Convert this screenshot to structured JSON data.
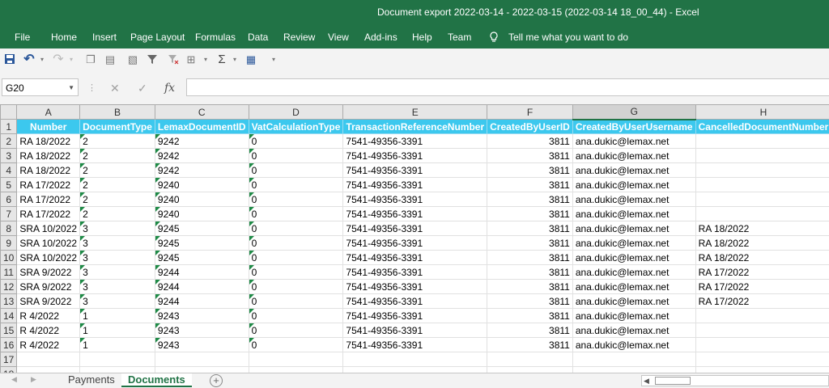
{
  "window": {
    "title": "Document export 2022-03-14 - 2022-03-15 (2022-03-14 18_00_44)  -  Excel"
  },
  "ribbon": {
    "tabs": [
      "File",
      "Home",
      "Insert",
      "Page Layout",
      "Formulas",
      "Data",
      "Review",
      "View",
      "Add-ins",
      "Help",
      "Team"
    ],
    "tell_me": "Tell me what you want to do"
  },
  "quick_access": {
    "icons": [
      "save-icon",
      "undo-icon",
      "redo-icon",
      "copy-icon",
      "paste-icon",
      "format-icon",
      "filter-icon",
      "clear-filter-icon",
      "table-icon",
      "autosum-icon",
      "pivot-icon",
      "customize-icon"
    ]
  },
  "formula_bar": {
    "name_box": "G20",
    "cancel": "✕",
    "enter": "✓",
    "fx": "fx",
    "value": ""
  },
  "grid": {
    "selected_column": "G",
    "columns": [
      "A",
      "B",
      "C",
      "D",
      "E",
      "F",
      "G",
      "H"
    ],
    "header_row": [
      "Number",
      "DocumentType",
      "LemaxDocumentID",
      "VatCalculationType",
      "TransactionReferenceNumber",
      "CreatedByUserID",
      "CreatedByUserUsername",
      "CancelledDocumentNumber"
    ],
    "rows": [
      [
        "RA 18/2022",
        "2",
        "9242",
        "0",
        "7541-49356-3391",
        "3811",
        "ana.dukic@lemax.net",
        ""
      ],
      [
        "RA 18/2022",
        "2",
        "9242",
        "0",
        "7541-49356-3391",
        "3811",
        "ana.dukic@lemax.net",
        ""
      ],
      [
        "RA 18/2022",
        "2",
        "9242",
        "0",
        "7541-49356-3391",
        "3811",
        "ana.dukic@lemax.net",
        ""
      ],
      [
        "RA 17/2022",
        "2",
        "9240",
        "0",
        "7541-49356-3391",
        "3811",
        "ana.dukic@lemax.net",
        ""
      ],
      [
        "RA 17/2022",
        "2",
        "9240",
        "0",
        "7541-49356-3391",
        "3811",
        "ana.dukic@lemax.net",
        ""
      ],
      [
        "RA 17/2022",
        "2",
        "9240",
        "0",
        "7541-49356-3391",
        "3811",
        "ana.dukic@lemax.net",
        ""
      ],
      [
        "SRA 10/2022",
        "3",
        "9245",
        "0",
        "7541-49356-3391",
        "3811",
        "ana.dukic@lemax.net",
        "RA 18/2022"
      ],
      [
        "SRA 10/2022",
        "3",
        "9245",
        "0",
        "7541-49356-3391",
        "3811",
        "ana.dukic@lemax.net",
        "RA 18/2022"
      ],
      [
        "SRA 10/2022",
        "3",
        "9245",
        "0",
        "7541-49356-3391",
        "3811",
        "ana.dukic@lemax.net",
        "RA 18/2022"
      ],
      [
        "SRA 9/2022",
        "3",
        "9244",
        "0",
        "7541-49356-3391",
        "3811",
        "ana.dukic@lemax.net",
        "RA 17/2022"
      ],
      [
        "SRA 9/2022",
        "3",
        "9244",
        "0",
        "7541-49356-3391",
        "3811",
        "ana.dukic@lemax.net",
        "RA 17/2022"
      ],
      [
        "SRA 9/2022",
        "3",
        "9244",
        "0",
        "7541-49356-3391",
        "3811",
        "ana.dukic@lemax.net",
        "RA 17/2022"
      ],
      [
        "R 4/2022",
        "1",
        "9243",
        "0",
        "7541-49356-3391",
        "3811",
        "ana.dukic@lemax.net",
        ""
      ],
      [
        "R 4/2022",
        "1",
        "9243",
        "0",
        "7541-49356-3391",
        "3811",
        "ana.dukic@lemax.net",
        ""
      ],
      [
        "R 4/2022",
        "1",
        "9243",
        "0",
        "7541-49356-3391",
        "3811",
        "ana.dukic@lemax.net",
        ""
      ]
    ],
    "row_numbers": [
      "1",
      "2",
      "3",
      "4",
      "5",
      "6",
      "7",
      "8",
      "9",
      "10",
      "11",
      "12",
      "13",
      "14",
      "15",
      "16",
      "17",
      "18"
    ]
  },
  "sheets": {
    "tabs": [
      "Payments",
      "Documents"
    ],
    "active": "Documents",
    "add": "+"
  },
  "colors": {
    "excel_green": "#217346",
    "header_fill": "#3cc8ee"
  }
}
